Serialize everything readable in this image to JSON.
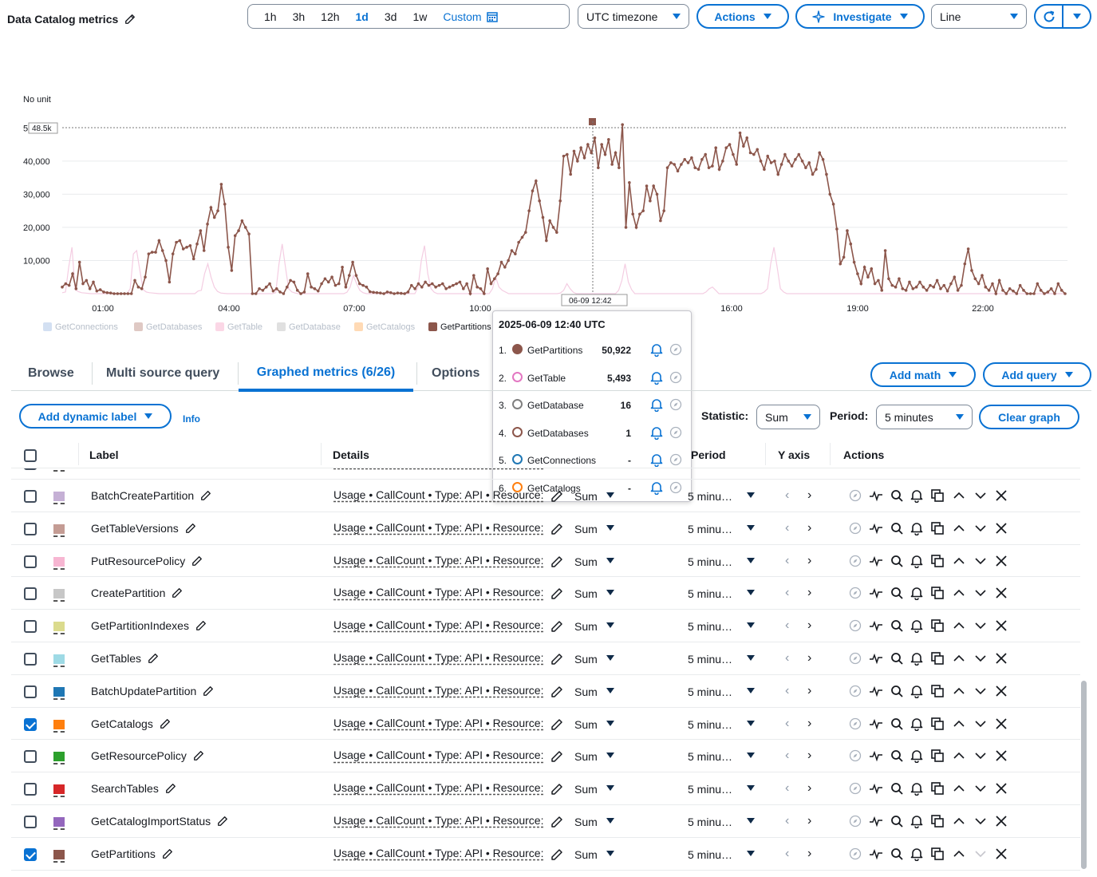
{
  "header": {
    "title": "Data Catalog metrics",
    "time_ranges": [
      "1h",
      "3h",
      "12h",
      "1d",
      "3d",
      "1w"
    ],
    "active_range": "1d",
    "custom_label": "Custom",
    "timezone_label": "UTC timezone",
    "actions_label": "Actions",
    "investigate_label": "Investigate",
    "chart_type_label": "Line"
  },
  "chart_data": {
    "type": "line",
    "ylabel": "No unit",
    "y_ticks": [
      "10,000",
      "20,000",
      "30,000",
      "40,000",
      "50,000"
    ],
    "x_ticks": [
      "01:00",
      "04:00",
      "07:00",
      "10:00",
      "16:00",
      "19:00",
      "22:00"
    ],
    "threshold_label": "48.5k",
    "cursor_label": "06-09 12:42",
    "ylim": [
      0,
      52000
    ],
    "legend": [
      "GetConnections",
      "GetDatabases",
      "GetTable",
      "GetDatabase",
      "GetCatalogs",
      "GetPartitions"
    ],
    "series": [
      {
        "name": "GetPartitions",
        "color": "#8c564b",
        "values": [
          2000,
          3000,
          2500,
          6000,
          1500,
          9500,
          3000,
          4000,
          1500,
          3500,
          800,
          1200,
          500,
          300,
          200,
          0,
          0,
          0,
          0,
          0,
          0,
          4000,
          2000,
          1500,
          5000,
          12000,
          12500,
          12500,
          16000,
          13000,
          10000,
          3500,
          12000,
          15500,
          16000,
          13500,
          14000,
          14500,
          10500,
          15000,
          19000,
          13000,
          21000,
          26000,
          23000,
          25000,
          33000,
          27000,
          14000,
          7000,
          17500,
          19000,
          22000,
          20000,
          18000,
          0,
          0,
          1500,
          1000,
          2000,
          3000,
          800,
          1500,
          500,
          0,
          2000,
          4000,
          3500,
          1000,
          0,
          500,
          6000,
          2000,
          1500,
          800,
          3000,
          4500,
          3500,
          5000,
          2500,
          3000,
          8000,
          2000,
          5500,
          9500,
          5500,
          3000,
          2500,
          2000,
          600,
          400,
          300,
          200,
          0,
          500,
          300,
          0,
          200,
          100,
          0,
          500,
          2500,
          1500,
          3000,
          2000,
          3500,
          2500,
          3000,
          2000,
          2500,
          3000,
          1500,
          2000,
          2500,
          3000,
          3500,
          1500,
          3000,
          0,
          5500,
          2000,
          1500,
          0,
          7500,
          3000,
          4500,
          6000,
          9500,
          8000,
          10000,
          13000,
          12000,
          15500,
          17000,
          18500,
          25000,
          31000,
          34000,
          28000,
          23000,
          16000,
          22000,
          20000,
          18500,
          28000,
          41500,
          42000,
          36000,
          43000,
          40000,
          44000,
          41000,
          45000,
          42500,
          47000,
          38000,
          45000,
          42000,
          46500,
          39000,
          42500,
          38000,
          51000,
          20000,
          33500,
          24000,
          20000,
          24000,
          25000,
          32500,
          28000,
          32500,
          30000,
          22000,
          25000,
          38000,
          39500,
          39000,
          37000,
          39000,
          40500,
          39500,
          41000,
          38000,
          37500,
          40500,
          42000,
          38000,
          38500,
          44000,
          37500,
          40000,
          44000,
          45000,
          42000,
          39000,
          48500,
          44500,
          47000,
          42500,
          42000,
          43500,
          40000,
          37500,
          41500,
          39500,
          40000,
          36000,
          39000,
          42000,
          40000,
          38500,
          40500,
          42000,
          40000,
          38000,
          39500,
          36000,
          37500,
          42500,
          40500,
          36000,
          30000,
          27000,
          19500,
          9000,
          11000,
          19000,
          15000,
          9500,
          6000,
          3000,
          8000,
          5000,
          7500,
          3000,
          4000,
          1000,
          13000,
          4500,
          2500,
          2000,
          4500,
          1500,
          1000,
          3500,
          1500,
          2000,
          3500,
          2000,
          1000,
          2500,
          2000,
          4000,
          1500,
          2500,
          800,
          3000,
          5000,
          1000,
          2500,
          9000,
          13500,
          7000,
          4500,
          3000,
          5500,
          2000,
          1000,
          3000,
          0,
          4000,
          1000,
          0,
          1500,
          800,
          0,
          2500,
          1000,
          0,
          0,
          0,
          3000,
          1000,
          0,
          500,
          1500,
          0,
          3000,
          1000,
          0
        ]
      },
      {
        "name": "GetTable",
        "color": "#e377c2",
        "values": [
          300,
          500,
          8000,
          14000,
          1200,
          600,
          300,
          200,
          100,
          0,
          0,
          0,
          0,
          0,
          0,
          0,
          0,
          0,
          0,
          0,
          0,
          1500,
          12000,
          13000,
          7000,
          1200,
          500,
          300,
          200,
          100,
          0,
          0,
          0,
          0,
          0,
          0,
          0,
          0,
          0,
          0,
          0,
          0,
          800,
          1000,
          6000,
          9000,
          5000,
          2000,
          700,
          200,
          100,
          0,
          0,
          0,
          0,
          0,
          0,
          0,
          0,
          0,
          0,
          0,
          0,
          0,
          0,
          0,
          300,
          9000,
          15000,
          8000,
          1500,
          500,
          200,
          0,
          0,
          0,
          0,
          0,
          0,
          0,
          0,
          0,
          0,
          0,
          0,
          0,
          0,
          0,
          400,
          2000,
          5500,
          3000,
          1000,
          300,
          0,
          0,
          0,
          0,
          0,
          0,
          0,
          0,
          0,
          0,
          0,
          0,
          0,
          0,
          0,
          0,
          2000,
          10000,
          14500,
          6000,
          1500,
          400,
          0,
          0,
          0,
          0,
          0,
          0,
          0,
          0,
          0,
          0,
          0,
          0,
          0,
          0,
          0,
          0,
          0,
          1500,
          5000,
          2000,
          1000,
          500,
          0,
          0,
          0,
          0,
          0,
          0,
          0,
          0,
          0,
          0,
          0,
          0,
          0,
          0,
          0,
          0,
          200,
          1000,
          3000,
          1500,
          400,
          0,
          0,
          0,
          0,
          0,
          0,
          0,
          0,
          0,
          0,
          0,
          0,
          0,
          1000,
          4000,
          9000,
          3500,
          1200,
          0,
          0,
          0,
          0,
          0,
          0,
          0,
          0,
          0,
          0,
          0,
          0,
          0,
          0,
          0,
          0,
          0,
          0,
          0,
          0,
          0,
          0,
          500,
          1500,
          2000,
          1000,
          0,
          0,
          0,
          0,
          0,
          0,
          0,
          0,
          0,
          0,
          0,
          0,
          0,
          0,
          500,
          1500,
          9000,
          14000,
          8000,
          1500,
          500,
          0,
          0,
          0,
          0,
          0,
          0,
          0,
          0,
          0,
          0,
          0,
          0,
          0,
          0,
          0,
          0,
          0,
          0,
          0,
          0,
          0,
          0,
          0,
          0,
          0,
          0,
          0,
          0,
          0,
          0,
          0,
          0,
          0,
          0,
          0,
          0,
          0,
          0,
          0,
          0,
          0,
          0,
          0,
          0,
          0,
          0,
          0,
          0,
          0,
          0,
          0,
          0,
          0,
          0,
          0,
          0,
          0,
          0,
          0,
          0,
          0,
          0,
          0,
          0,
          0,
          0,
          0,
          0,
          0,
          0,
          0,
          0,
          0,
          0,
          0,
          0,
          0,
          0,
          0,
          0,
          0,
          0,
          0,
          0,
          0,
          0,
          0
        ]
      }
    ]
  },
  "tooltip": {
    "header": "2025-06-09 12:40 UTC",
    "entries": [
      {
        "idx": "1.",
        "name": "GetPartitions",
        "value": "50,922",
        "color": "#8c564b",
        "filled": true
      },
      {
        "idx": "2.",
        "name": "GetTable",
        "value": "5,493",
        "color": "#e377c2",
        "filled": false
      },
      {
        "idx": "3.",
        "name": "GetDatabase",
        "value": "16",
        "color": "#7f7f7f",
        "filled": false
      },
      {
        "idx": "4.",
        "name": "GetDatabases",
        "value": "1",
        "color": "#8c564b",
        "filled": false
      },
      {
        "idx": "5.",
        "name": "GetConnections",
        "value": "-",
        "color": "#1f77b4",
        "filled": false
      },
      {
        "idx": "6.",
        "name": "GetCatalogs",
        "value": "-",
        "color": "#ff7f0e",
        "filled": false
      }
    ]
  },
  "tabs": {
    "browse": "Browse",
    "multi_source": "Multi source query",
    "graphed": "Graphed metrics (6/26)",
    "options": "Options",
    "add_math": "Add math",
    "add_query": "Add query"
  },
  "toolbar": {
    "add_dynamic_label": "Add dynamic label",
    "info": "Info",
    "statistic_label": "Statistic:",
    "statistic_value": "Sum",
    "period_label": "Period:",
    "period_value": "5 minutes",
    "clear_graph": "Clear graph"
  },
  "table": {
    "headers": {
      "label": "Label",
      "details": "Details",
      "period": "Period",
      "yaxis": "Y axis",
      "actions": "Actions"
    },
    "details_text": "Usage • CallCount • Type: API • Resource:",
    "stat_text": "Sum",
    "period_text": "5 minu…",
    "partial_row": {
      "label": "BatchGetPartition",
      "color": "#ff9896"
    },
    "rows": [
      {
        "label": "BatchCreatePartition",
        "color": "#c5b0d5",
        "checked": false
      },
      {
        "label": "GetTableVersions",
        "color": "#c49c94",
        "checked": false
      },
      {
        "label": "PutResourcePolicy",
        "color": "#f7b6d2",
        "checked": false
      },
      {
        "label": "CreatePartition",
        "color": "#c7c7c7",
        "checked": false
      },
      {
        "label": "GetPartitionIndexes",
        "color": "#dbdb8d",
        "checked": false
      },
      {
        "label": "GetTables",
        "color": "#9edae5",
        "checked": false
      },
      {
        "label": "BatchUpdatePartition",
        "color": "#1f77b4",
        "checked": false
      },
      {
        "label": "GetCatalogs",
        "color": "#ff7f0e",
        "checked": true
      },
      {
        "label": "GetResourcePolicy",
        "color": "#2ca02c",
        "checked": false
      },
      {
        "label": "SearchTables",
        "color": "#d62728",
        "checked": false
      },
      {
        "label": "GetCatalogImportStatus",
        "color": "#9467bd",
        "checked": false
      },
      {
        "label": "GetPartitions",
        "color": "#8c564b",
        "checked": true
      }
    ]
  }
}
